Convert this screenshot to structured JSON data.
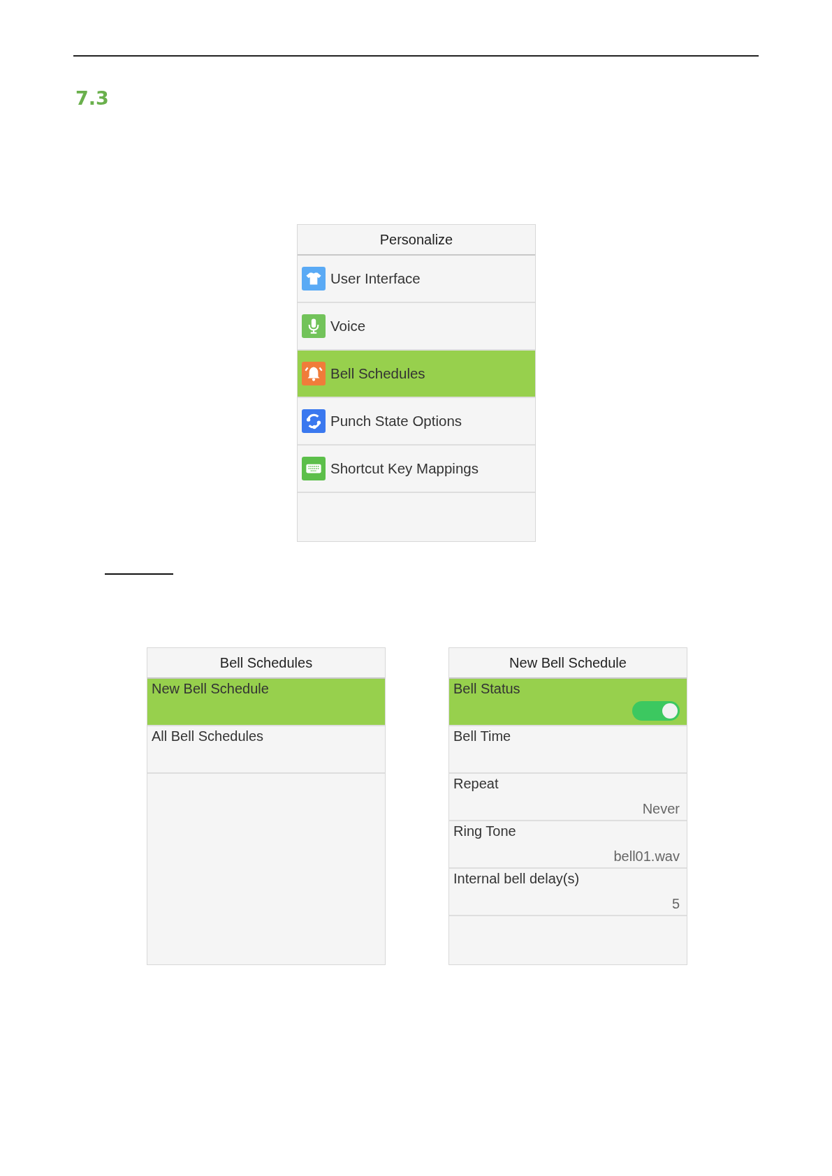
{
  "section_number": "7.3",
  "personalize_screen": {
    "title": "Personalize",
    "items": [
      {
        "label": "User Interface",
        "kind": "shirt",
        "selected": false
      },
      {
        "label": "Voice",
        "kind": "mic",
        "selected": false
      },
      {
        "label": "Bell Schedules",
        "kind": "bell",
        "selected": true
      },
      {
        "label": "Punch State Options",
        "kind": "sync",
        "selected": false
      },
      {
        "label": "Shortcut Key Mappings",
        "kind": "keyboard",
        "selected": false
      }
    ]
  },
  "bell_schedules_screen": {
    "title": "Bell Schedules",
    "items": [
      {
        "label": "New Bell Schedule",
        "selected": true
      },
      {
        "label": "All Bell Schedules",
        "selected": false
      }
    ]
  },
  "new_bell_schedule_screen": {
    "title": "New Bell Schedule",
    "items": [
      {
        "label": "Bell Status",
        "kind": "toggle",
        "on": true,
        "selected": true
      },
      {
        "label": "Bell Time",
        "kind": "value",
        "selected": false
      },
      {
        "label": "Repeat",
        "kind": "value",
        "value": "Never",
        "selected": false
      },
      {
        "label": "Ring Tone",
        "kind": "value",
        "value": "bell01.wav",
        "selected": false
      },
      {
        "label": "Internal bell delay(s)",
        "kind": "value",
        "value": "5",
        "selected": false
      }
    ]
  }
}
